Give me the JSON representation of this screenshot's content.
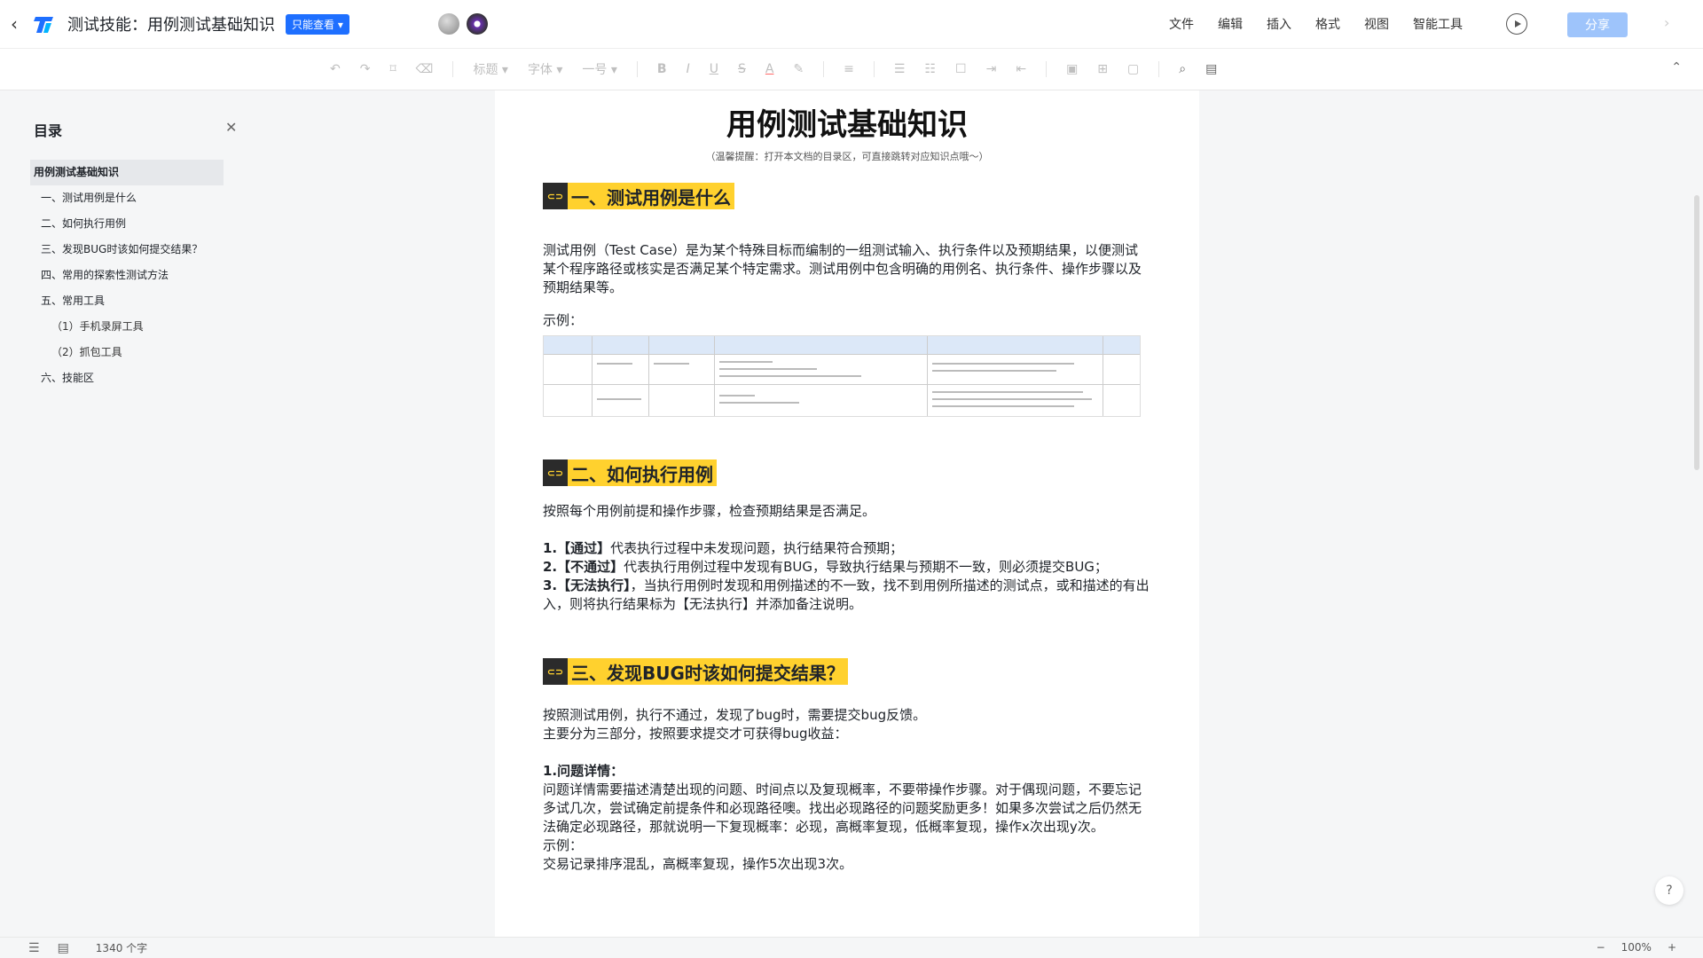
{
  "titlebar": {
    "title": "测试技能：用例测试基础知识",
    "badge": "只能查看",
    "menu": [
      "文件",
      "编辑",
      "插入",
      "格式",
      "视图",
      "智能工具"
    ],
    "share_label": "分享"
  },
  "toolbar": {
    "style": "标题",
    "font": "字体",
    "size": "一号"
  },
  "toc": {
    "title": "目录",
    "items": [
      "用例测试基础知识",
      "一、测试用例是什么",
      "二、如何执行用例",
      "三、发现BUG时该如何提交结果？",
      "四、常用的探索性测试方法",
      "五、常用工具",
      "（1）手机录屏工具",
      "（2）抓包工具",
      "六、技能区"
    ]
  },
  "doc": {
    "title": "用例测试基础知识",
    "tip": "（温馨提醒：打开本文档的目录区，可直接跳转对应知识点哦～）",
    "s1": {
      "heading": "一、测试用例是什么",
      "para": "测试用例（Test Case）是为某个特殊目标而编制的一组测试输入、执行条件以及预期结果，以便测试某个程序路径或核实是否满足某个特定需求。测试用例中包含明确的用例名、执行条件、操作步骤以及预期结果等。",
      "example": "示例："
    },
    "s2": {
      "heading": "二、如何执行用例",
      "intro": "按照每个用例前提和操作步骤，检查预期结果是否满足。",
      "i1_label": "1.【通过】",
      "i1_text": "代表执行过程中未发现问题，执行结果符合预期；",
      "i2_label": "2.【不通过】",
      "i2_text": "代表执行用例过程中发现有BUG，导致执行结果与预期不一致，则必须提交BUG；",
      "i3_label": "3.【无法执行】",
      "i3_text": "，当执行用例时发现和用例描述的不一致，找不到用例所描述的测试点，或和描述的有出入，则将执行结果标为【无法执行】并添加备注说明。"
    },
    "s3": {
      "heading": "三、发现BUG时该如何提交结果？",
      "line1": "按照测试用例，执行不通过，发现了bug时，需要提交bug反馈。",
      "line2": "主要分为三部分，按照要求提交才可获得bug收益：",
      "sub": "1.问题详情：",
      "para": "问题详情需要描述清楚出现的问题、时间点以及复现概率，不要带操作步骤。对于偶现问题，不要忘记多试几次，尝试确定前提条件和必现路径噢。找出必现路径的问题奖励更多！如果多次尝试之后仍然无法确定必现路径，那就说明一下复现概率：必现，高概率复现，低概率复现，操作x次出现y次。",
      "ex_label": "示例：",
      "ex_text": "交易记录排序混乱，高概率复现，操作5次出现3次。"
    }
  },
  "status": {
    "wordcount": "1340 个字",
    "zoom": "100%",
    "zoom_minus": "−",
    "zoom_plus": "+"
  },
  "help": "?"
}
